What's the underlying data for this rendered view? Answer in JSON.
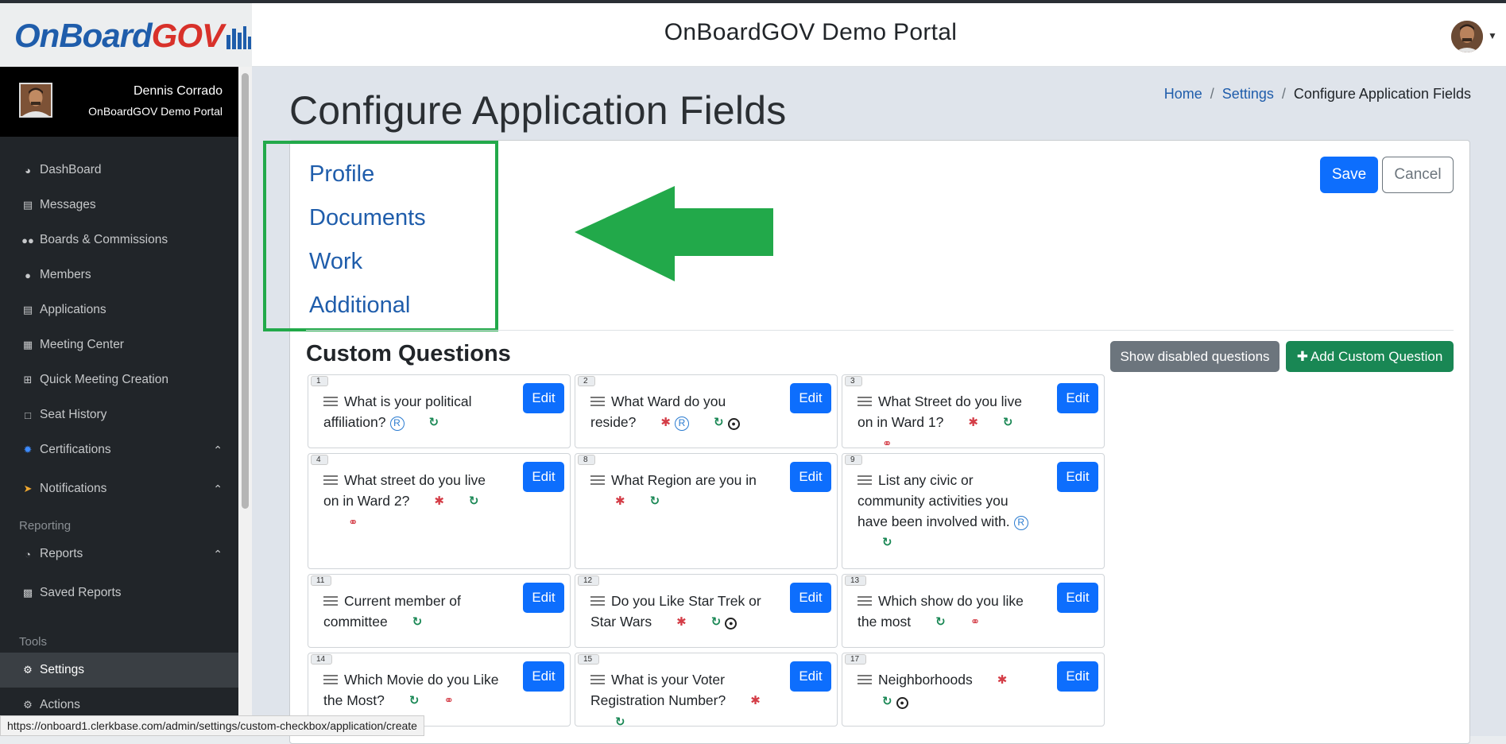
{
  "header": {
    "logo_on": "OnBoard",
    "logo_gov": "GOV",
    "portal_title": "OnBoardGOV Demo Portal"
  },
  "user": {
    "name": "Dennis Corrado",
    "portal": "OnBoardGOV Demo Portal"
  },
  "sidebar": {
    "items": [
      {
        "label": "DashBoard",
        "icon": "dashboard-icon"
      },
      {
        "label": "Messages",
        "icon": "inbox-icon"
      },
      {
        "label": "Boards & Commissions",
        "icon": "users-icon"
      },
      {
        "label": "Members",
        "icon": "user-icon"
      },
      {
        "label": "Applications",
        "icon": "id-card-icon"
      },
      {
        "label": "Meeting Center",
        "icon": "calendar-icon"
      },
      {
        "label": "Quick Meeting Creation",
        "icon": "calendar-plus-icon"
      },
      {
        "label": "Seat History",
        "icon": "couch-icon"
      },
      {
        "label": "Certifications",
        "icon": "certificate-icon"
      },
      {
        "label": "Notifications",
        "icon": "paper-plane-icon"
      }
    ],
    "reporting_heading": "Reporting",
    "reports": [
      {
        "label": "Reports",
        "icon": "pie-chart-icon"
      },
      {
        "label": "Saved Reports",
        "icon": "save-icon"
      }
    ],
    "tools_heading": "Tools",
    "tools": [
      {
        "label": "Settings",
        "icon": "gear-icon",
        "active": true
      },
      {
        "label": "Actions",
        "icon": "gears-icon"
      }
    ]
  },
  "page": {
    "title": "Configure Application Fields",
    "breadcrumb": [
      "Home",
      "Settings",
      "Configure Application Fields"
    ],
    "breadcrumb_sep": "/"
  },
  "tabs": [
    "Profile",
    "Documents",
    "Work",
    "Additional"
  ],
  "actions": {
    "save": "Save",
    "cancel": "Cancel"
  },
  "custom_questions": {
    "title": "Custom Questions",
    "show_disabled": "Show disabled questions",
    "add": "Add Custom Question",
    "edit_label": "Edit",
    "items": [
      {
        "num": "1",
        "text": "What is your political affiliation?",
        "icons": [
          "registered",
          "sync"
        ]
      },
      {
        "num": "2",
        "text": "What Ward do you reside?",
        "icons": [
          "required",
          "registered",
          "sync",
          "target"
        ]
      },
      {
        "num": "3",
        "text": "What Street do you live on in Ward 1?",
        "icons": [
          "required",
          "sync",
          "link"
        ]
      },
      {
        "num": "4",
        "text": "What street do you live on in Ward 2?",
        "icons": [
          "required",
          "sync",
          "link"
        ]
      },
      {
        "num": "8",
        "text": "What Region are you in",
        "icons": [
          "required",
          "sync"
        ]
      },
      {
        "num": "9",
        "text": "List any civic or community activities you have been involved with.",
        "icons": [
          "registered",
          "sync"
        ]
      },
      {
        "num": "11",
        "text": "Current member of committee",
        "icons": [
          "sync"
        ]
      },
      {
        "num": "12",
        "text": "Do you Like Star Trek or Star Wars",
        "icons": [
          "required",
          "sync",
          "target"
        ]
      },
      {
        "num": "13",
        "text": "Which show do you like the most",
        "icons": [
          "sync",
          "link"
        ]
      },
      {
        "num": "14",
        "text": "Which Movie do you Like the Most?",
        "icons": [
          "sync",
          "link"
        ]
      },
      {
        "num": "15",
        "text": "What is your Voter Registration Number?",
        "icons": [
          "required",
          "sync"
        ]
      },
      {
        "num": "17",
        "text": "Neighborhoods",
        "icons": [
          "required",
          "sync",
          "target"
        ]
      }
    ]
  },
  "status_url": "https://onboard1.clerkbase.com/admin/settings/custom-checkbox/application/create",
  "colors": {
    "highlight_box": "#22a94a",
    "arrow": "#22a94a",
    "primary": "#0d6efd",
    "success": "#198754",
    "link": "#1f5dab",
    "required": "#d43d47"
  }
}
